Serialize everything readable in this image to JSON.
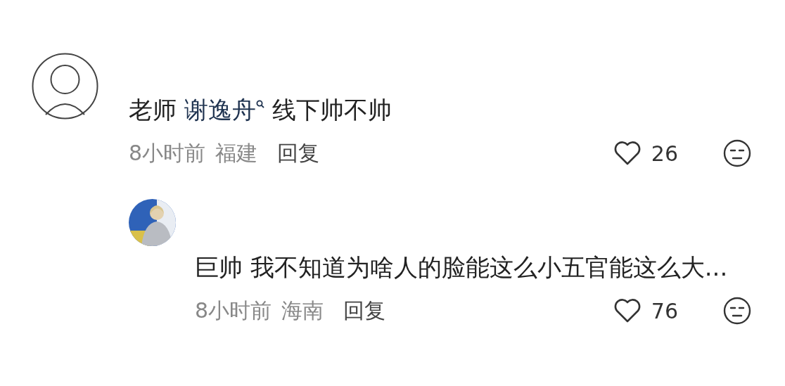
{
  "comments": [
    {
      "body": [
        {
          "kind": "text",
          "text": "老师 "
        },
        {
          "kind": "mention",
          "text": "谢逸舟"
        },
        {
          "kind": "text",
          "text": " 线下帅不帅"
        }
      ],
      "time": "8小时前",
      "location": "福建",
      "reply": "回复",
      "likes": "26",
      "replies": [
        {
          "body": [
            {
              "kind": "text",
              "text": "巨帅 我不知道为啥人的脸能这么小五官能这么大..."
            }
          ],
          "time": "8小时前",
          "location": "海南",
          "reply": "回复",
          "likes": "76"
        }
      ]
    }
  ]
}
